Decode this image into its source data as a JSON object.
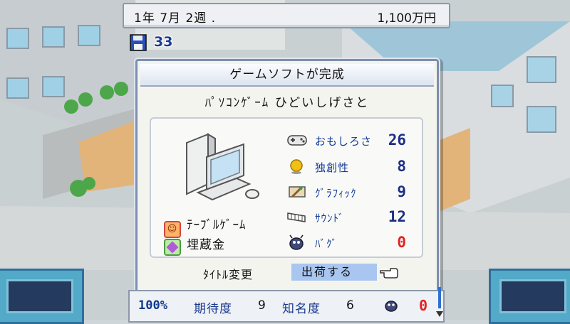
{
  "status": {
    "date": "1年  7月  2週 .",
    "money": "1,100万円"
  },
  "floppy_count": "33",
  "dialog": {
    "title": "ゲームソフトが完成",
    "game_name": "ﾊﾟｿｺﾝｹﾞｰﾑ ひどいしげさと",
    "genre": "ﾃｰﾌﾞﾙｹﾞｰﾑ",
    "theme": "埋蔵金",
    "stats": [
      {
        "label": "おもしろさ",
        "value": "26",
        "icon": "gamepad-icon"
      },
      {
        "label": "独創性",
        "value": "8",
        "icon": "gold-orb-icon"
      },
      {
        "label": "ｸﾞﾗﾌｨｯｸ",
        "value": "9",
        "icon": "paint-brush-icon"
      },
      {
        "label": "ｻｳﾝﾄﾞ",
        "value": "12",
        "icon": "keyboard-instrument-icon"
      },
      {
        "label": "ﾊﾞｸﾞ",
        "value": "0",
        "icon": "bug-icon"
      }
    ],
    "rename_label": "ﾀｲﾄﾙ変更",
    "ship_label": "出荷する"
  },
  "bottom": {
    "percent": "100%",
    "expectation_label": "期待度",
    "expectation_value": "9",
    "fame_label": "知名度",
    "fame_value": "6",
    "bug_value": "0"
  },
  "colors": {
    "accent": "#1c2f86",
    "bug": "#e32222",
    "dialog_border": "#7d8fb0",
    "selection": "#a9c6f0"
  }
}
